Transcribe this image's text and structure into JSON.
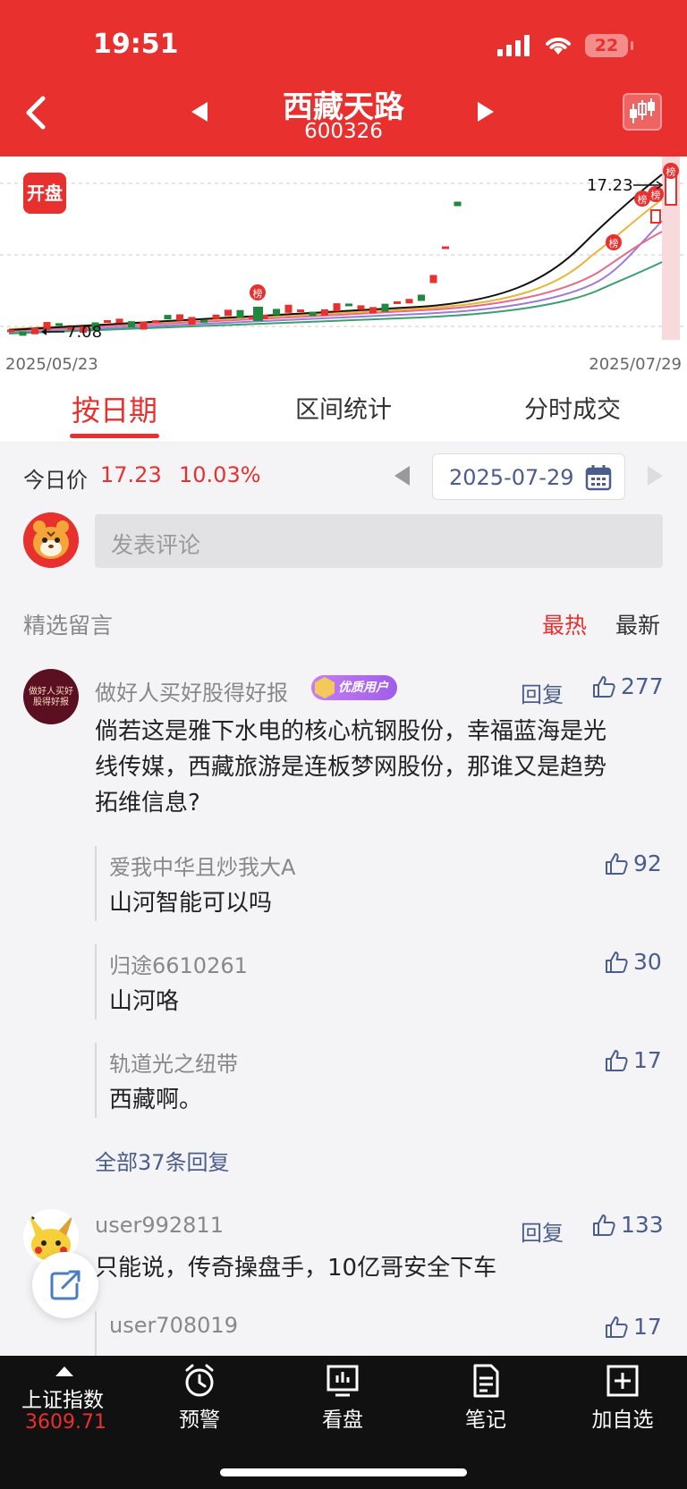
{
  "status": {
    "time": "19:51",
    "battery": "22"
  },
  "header": {
    "title": "西藏天路",
    "code": "600326"
  },
  "chart": {
    "badge": "开盘",
    "high_label": "17.23",
    "low_label": "7.08",
    "start_date": "2025/05/23",
    "end_date": "2025/07/29",
    "marker_label": "榜"
  },
  "tabs": [
    "按日期",
    "区间统计",
    "分时成交"
  ],
  "price_row": {
    "label": "今日价",
    "price": "17.23",
    "change": "10.03%",
    "date": "2025-07-29"
  },
  "comment_input": {
    "placeholder": "发表评论"
  },
  "section": {
    "title": "精选留言",
    "sort_hot": "最热",
    "sort_new": "最新"
  },
  "comments": [
    {
      "avatar_text": "做好人买好股得好报",
      "user": "做好人买好股得好报",
      "badge": "优质用户",
      "reply": "回复",
      "likes": "277",
      "text_lines": [
        "倘若这是雅下水电的核心杭钢股份，幸福蓝海是光",
        "线传媒，西藏旅游是连板梦网股份，那谁又是趋势",
        "拓维信息?"
      ],
      "replies": [
        {
          "user": "爱我中华且炒我大A",
          "likes": "92",
          "text": "山河智能可以吗"
        },
        {
          "user": "归途6610261",
          "likes": "30",
          "text": "山河咯"
        },
        {
          "user": "轨道光之纽带",
          "likes": "17",
          "text": "西藏啊。"
        }
      ],
      "more": "全部37条回复"
    },
    {
      "user": "user992811",
      "reply": "回复",
      "likes": "133",
      "text": "只能说，传奇操盘手，10亿哥安全下车",
      "replies": [
        {
          "user": "user708019",
          "likes": "17"
        }
      ]
    }
  ],
  "bottom_nav": {
    "index_name": "上证指数",
    "index_value": "3609.71",
    "items": [
      "预警",
      "看盘",
      "笔记",
      "加自选"
    ]
  },
  "colors": {
    "brand_red": "#e8302f",
    "link_blue": "#4a5d8c"
  }
}
